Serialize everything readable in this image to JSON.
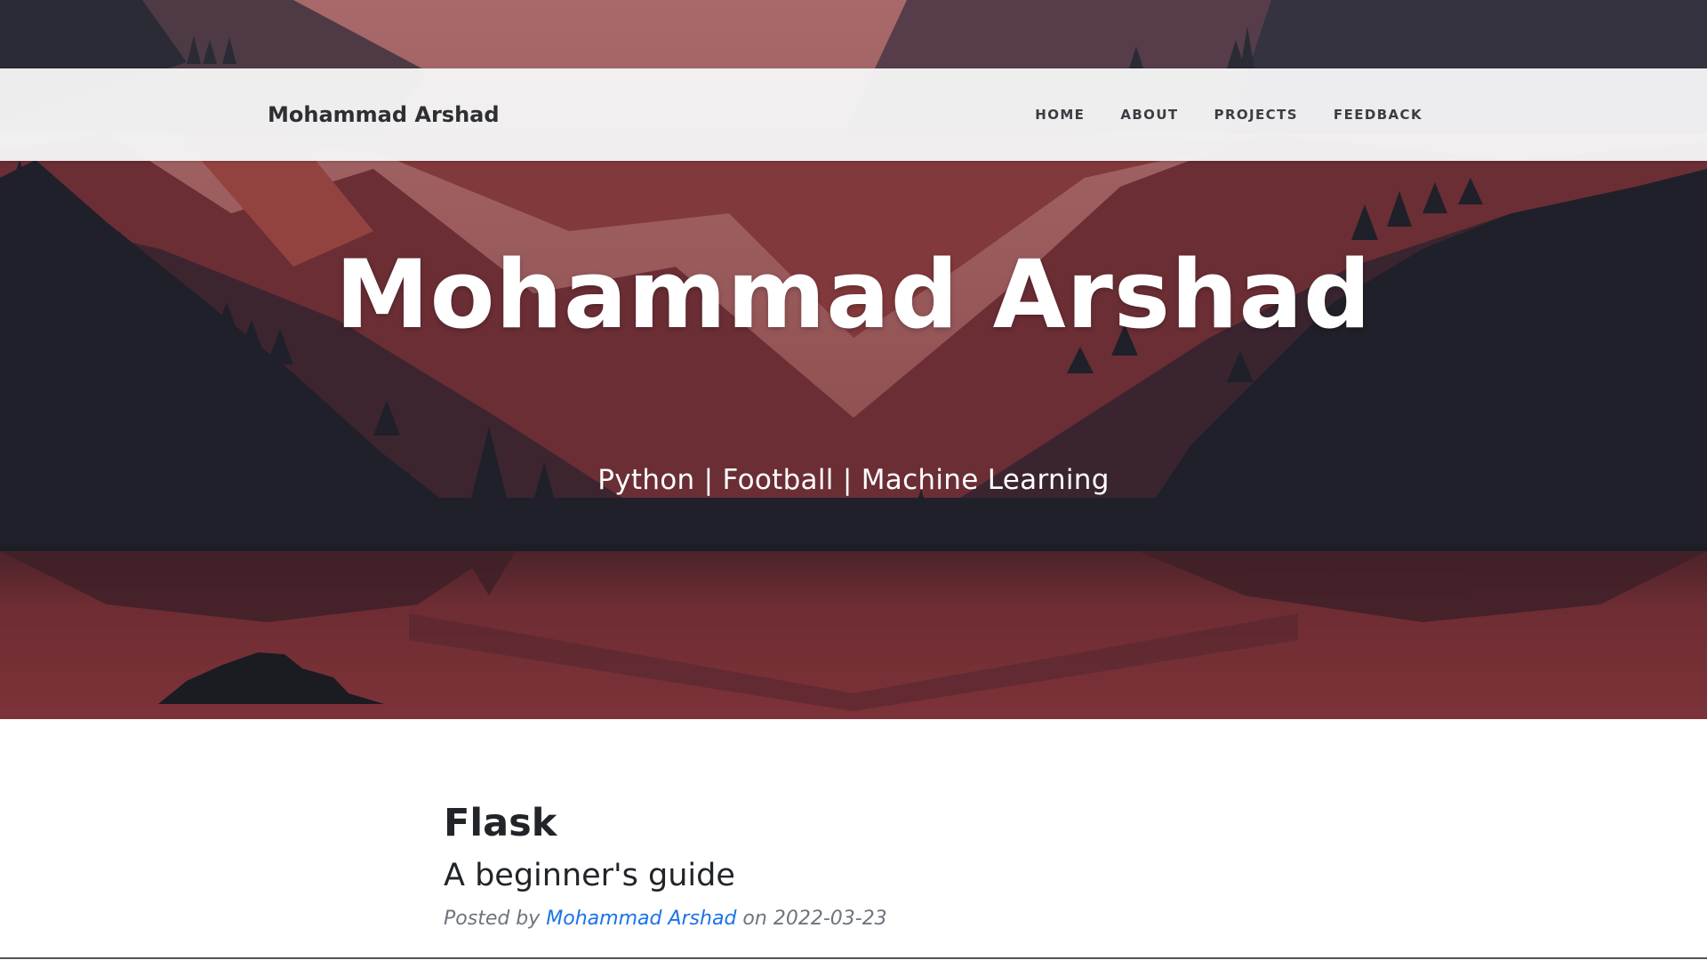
{
  "navbar": {
    "brand": "Mohammad Arshad",
    "links": [
      "HOME",
      "ABOUT",
      "PROJECTS",
      "FEEDBACK"
    ]
  },
  "hero": {
    "title": "Mohammad Arshad",
    "subtitle": "Python | Football | Machine Learning"
  },
  "post": {
    "title": "Flask",
    "subtitle": "A beginner's guide",
    "meta_prefix": "Posted by",
    "author": "Mohammad Arshad",
    "meta_on": "on",
    "date": "2022-03-23"
  },
  "colors": {
    "sky": "#a26669",
    "lake": "#6e2e33",
    "dark_silhouette": "#1f2029",
    "brand_text": "#2d2f33",
    "author_link": "#1a73e8"
  }
}
